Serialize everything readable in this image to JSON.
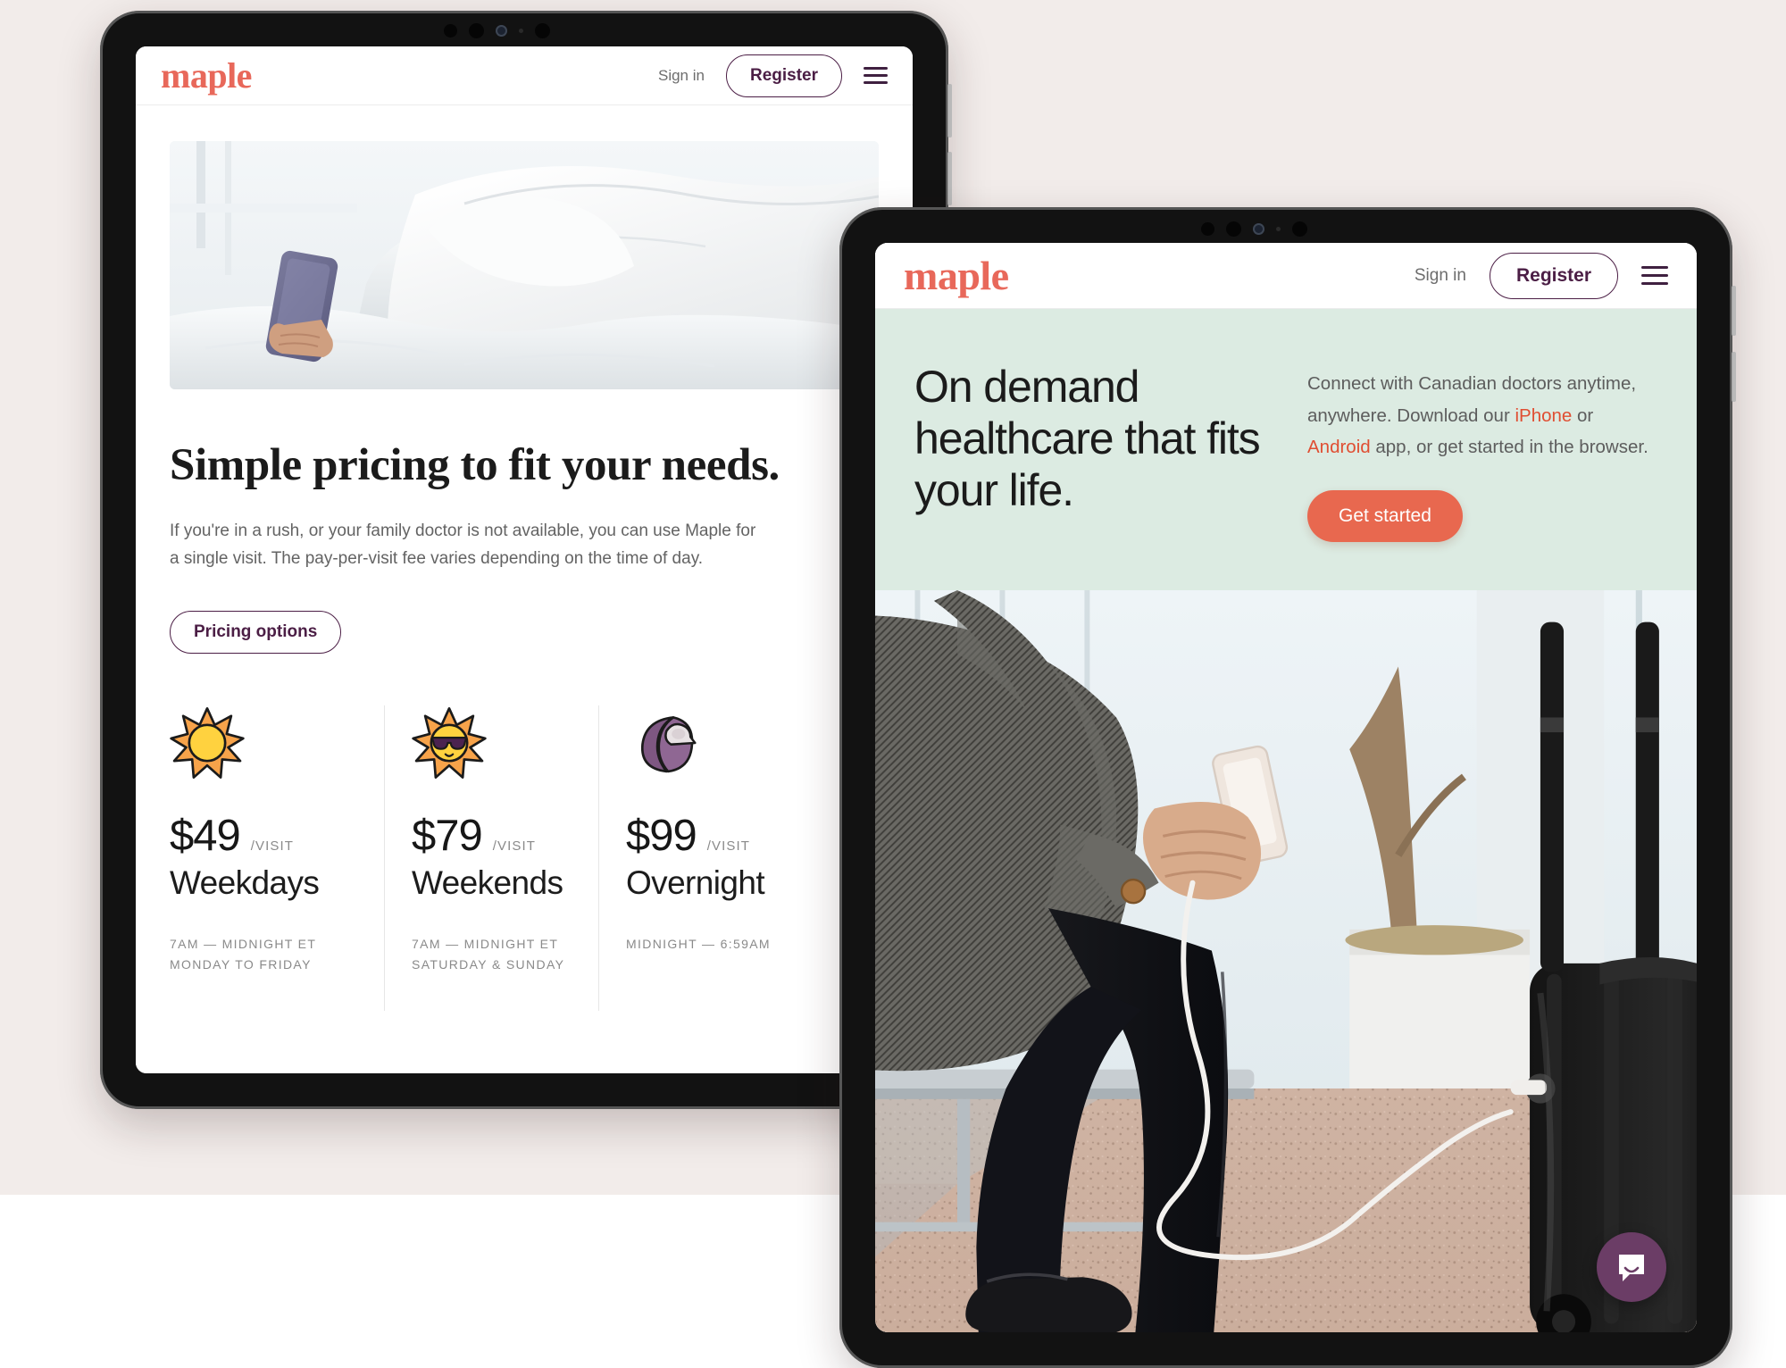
{
  "page": {
    "background_color": "#F2ECEA",
    "lower_band_color": "#FFFFFF"
  },
  "brand": {
    "name": "maple",
    "logo_color": "#E8685A",
    "accent_purple": "#4B1E45",
    "accent_coral": "#E8684F",
    "mint_band": "#DCEBE2"
  },
  "tablet_back": {
    "device": "tablet",
    "header": {
      "logo": "maple",
      "sign_in": "Sign in",
      "register": "Register",
      "menu_icon": "hamburger-menu-icon"
    },
    "hero_image_alt": "Person lying in bed under a white duvet holding a purple smartphone",
    "headline": "Simple pricing to fit your needs.",
    "body": "If you're in a rush, or your family doctor is not available, you can use Maple for a single visit. The pay-per-visit fee varies depending on the time of day.",
    "cta": "Pricing options",
    "pricing_cards": [
      {
        "icon": "sun-icon",
        "price": "$49",
        "per": "/VISIT",
        "title": "Weekdays",
        "meta_line1": "7AM — MIDNIGHT ET",
        "meta_line2": "MONDAY TO FRIDAY"
      },
      {
        "icon": "sun-with-sunglasses-icon",
        "price": "$79",
        "per": "/VISIT",
        "title": "Weekends",
        "meta_line1": "7AM — MIDNIGHT ET",
        "meta_line2": "SATURDAY & SUNDAY"
      },
      {
        "icon": "crescent-moon-icon",
        "price": "$99",
        "per": "/VISIT",
        "title": "Overnight",
        "meta_line1": "MIDNIGHT — 6:59AM",
        "meta_line2": ""
      }
    ]
  },
  "tablet_front": {
    "device": "tablet",
    "header": {
      "logo": "maple",
      "sign_in": "Sign in",
      "register": "Register",
      "menu_icon": "hamburger-menu-icon"
    },
    "hero": {
      "headline": "On demand healthcare that fits your life.",
      "copy_part1": "Connect with Canadian doctors anytime, anywhere. Download our ",
      "link_iphone": "iPhone",
      "copy_part2": " or ",
      "link_android": "Android",
      "copy_part3": " app, or get started in the browser.",
      "cta": "Get started"
    },
    "hero_image_alt": "Person seated on an airport bench with rolling luggage, holding a smartphone with earbuds plugged in",
    "chat_launcher": {
      "icon": "chat-bubble-icon",
      "color": "#6B3D66"
    }
  }
}
